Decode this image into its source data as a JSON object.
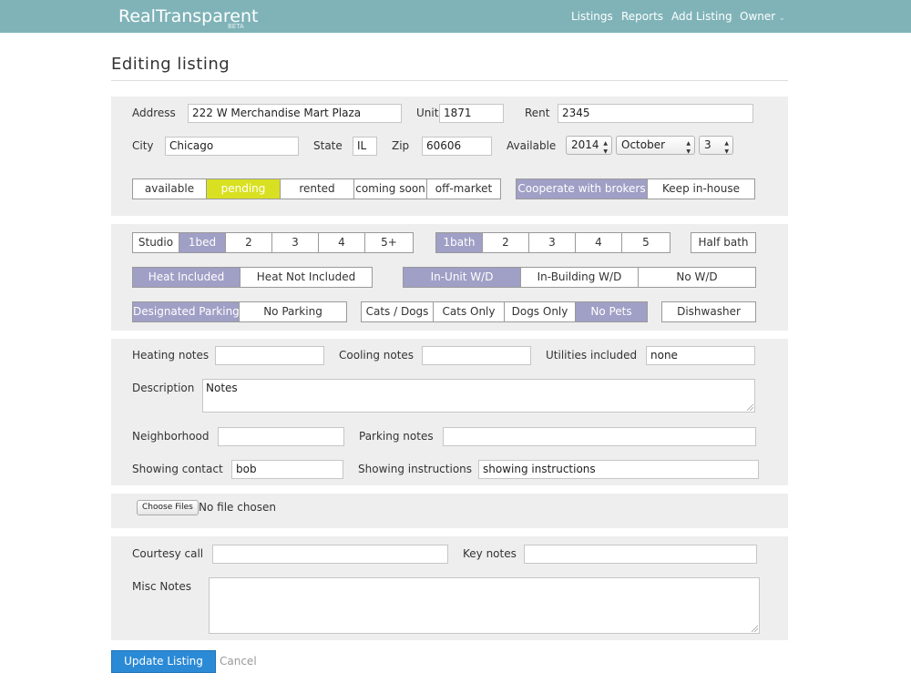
{
  "nav": {
    "brand": "RealTransparent",
    "beta": "BETA",
    "links": [
      "Listings",
      "Reports",
      "Add Listing"
    ],
    "owner": "Owner",
    "owner_caret": "⌄"
  },
  "page_title": "Editing listing",
  "location": {
    "address_label": "Address",
    "address_value": "222 W Merchandise Mart Plaza",
    "unit_label": "Unit",
    "unit_value": "1871",
    "rent_label": "Rent",
    "rent_value": "2345",
    "city_label": "City",
    "city_value": "Chicago",
    "state_label": "State",
    "state_value": "IL",
    "zip_label": "Zip",
    "zip_value": "60606",
    "available_label": "Available",
    "year_value": "2014",
    "month_value": "October",
    "day_value": "3",
    "status_options": [
      "available",
      "pending",
      "rented",
      "coming soon",
      "off-market"
    ],
    "status_selected": "pending",
    "broker_options": [
      "Cooperate with brokers",
      "Keep in-house"
    ],
    "broker_selected": "Cooperate with brokers"
  },
  "features": {
    "beds": [
      "Studio",
      "1bed",
      "2",
      "3",
      "4",
      "5+"
    ],
    "beds_selected": "1bed",
    "baths": [
      "1bath",
      "2",
      "3",
      "4",
      "5"
    ],
    "baths_selected": "1bath",
    "half_bath": "Half bath",
    "heat": [
      "Heat Included",
      "Heat Not Included"
    ],
    "heat_selected": "Heat Included",
    "laundry": [
      "In-Unit W/D",
      "In-Building W/D",
      "No W/D"
    ],
    "laundry_selected": "In-Unit W/D",
    "parking": [
      "Designated Parking",
      "No Parking"
    ],
    "parking_selected": "Designated Parking",
    "pets": [
      "Cats / Dogs",
      "Cats Only",
      "Dogs Only",
      "No Pets"
    ],
    "pets_selected": "No Pets",
    "dishwasher": "Dishwasher"
  },
  "notes": {
    "heating_label": "Heating notes",
    "heating_value": "",
    "cooling_label": "Cooling notes",
    "cooling_value": "",
    "utilities_label": "Utilities included",
    "utilities_value": "none",
    "description_label": "Description",
    "description_value": "Notes",
    "neighborhood_label": "Neighborhood",
    "neighborhood_value": "",
    "parking_notes_label": "Parking notes",
    "parking_notes_value": "",
    "showing_contact_label": "Showing contact",
    "showing_contact_value": "bob",
    "showing_instructions_label": "Showing instructions",
    "showing_instructions_value": "showing instructions"
  },
  "files": {
    "button": "Choose Files",
    "status": "No file chosen"
  },
  "extra": {
    "courtesy_label": "Courtesy call",
    "courtesy_value": "",
    "key_notes_label": "Key notes",
    "key_notes_value": "",
    "misc_label": "Misc Notes",
    "misc_value": ""
  },
  "actions": {
    "submit": "Update Listing",
    "cancel": "Cancel"
  },
  "colors": {
    "navbar": "#7fb3b8",
    "selected": "#a09fc6",
    "pending": "#d9e021",
    "primary": "#2b8ad6"
  }
}
